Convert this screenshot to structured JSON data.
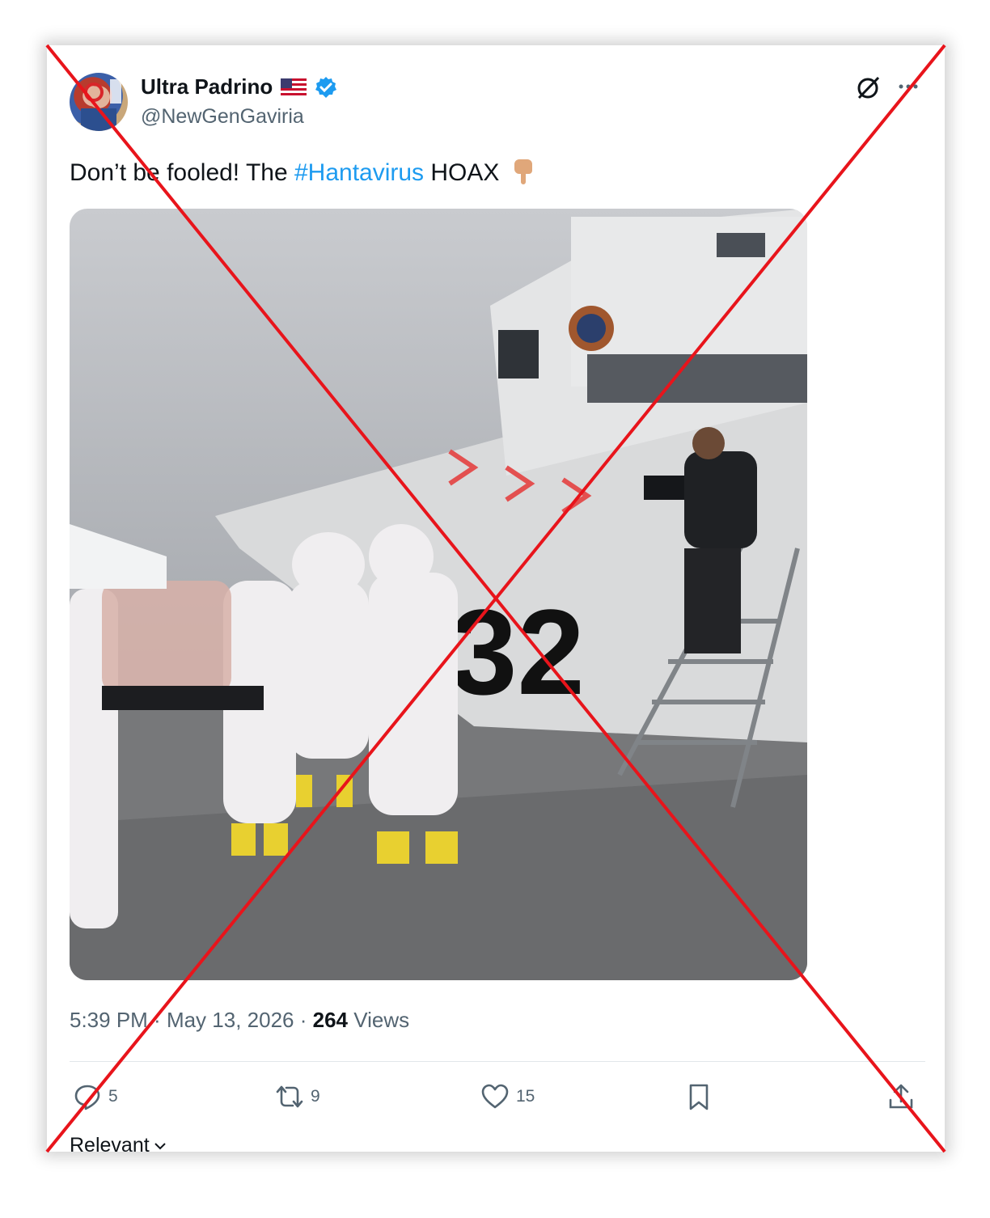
{
  "tweet": {
    "display_name": "Ultra Padrino",
    "handle": "@NewGenGaviria",
    "text_before": "Don’t be fooled! The ",
    "hashtag": "#Hantavirus",
    "text_after": " HOAX",
    "photo_text": "32",
    "time": "5:39 PM",
    "separator": " · ",
    "date": "May 13, 2026",
    "views_count": "264",
    "views_label": " Views"
  },
  "actions": {
    "replies": "5",
    "retweets": "9",
    "likes": "15"
  },
  "sort": {
    "label": "Relevant"
  },
  "icons": [
    "avatar",
    "us-flag-icon",
    "verified-badge-icon",
    "grok-icon",
    "more-icon",
    "pointing-down-icon",
    "reply-icon",
    "retweet-icon",
    "like-icon",
    "bookmark-icon",
    "share-icon",
    "chevron-down-icon"
  ],
  "colors": {
    "hashtag": "#1d9bf0",
    "text": "#0f1419",
    "secondary": "#536471",
    "verified": "#1d9bf0",
    "cross": "#e8141b"
  }
}
